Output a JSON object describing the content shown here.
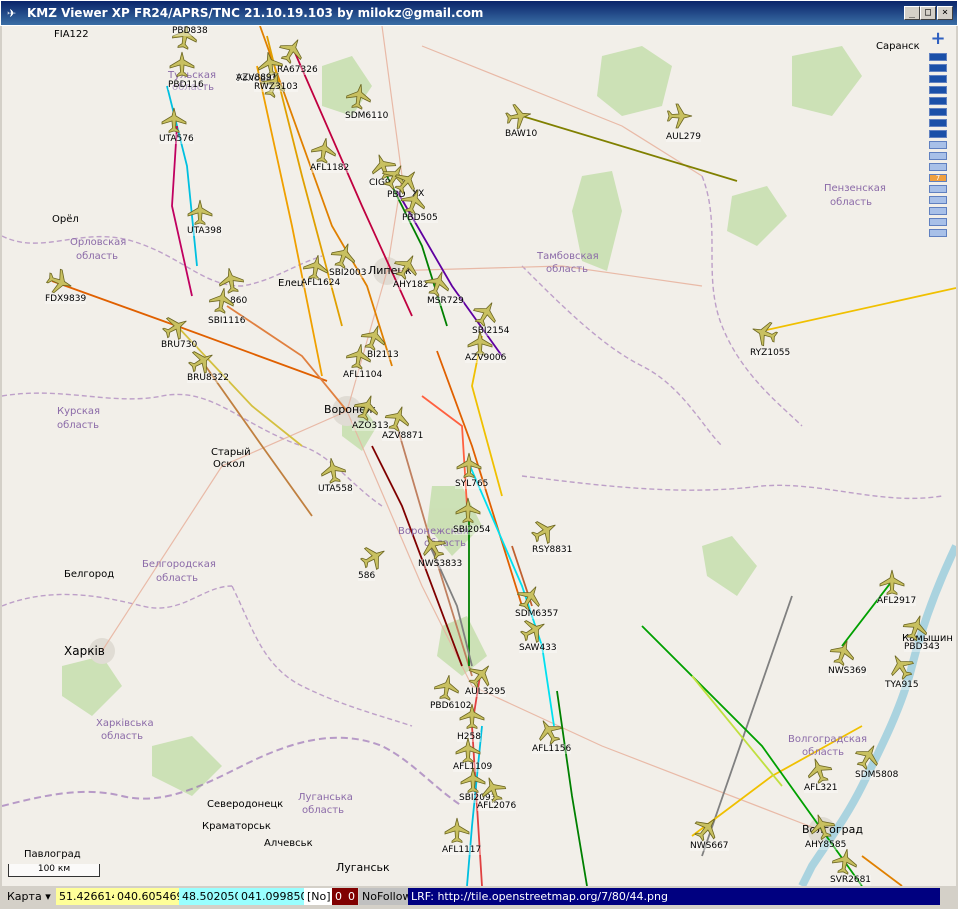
{
  "window": {
    "title": "KMZ Viewer XP FR24/APRS/TNC 21.10.19.103 by milokz@gmail.com",
    "minimize_glyph": "_",
    "maximize_glyph": "□",
    "close_glyph": "×"
  },
  "map": {
    "places": [
      {
        "name": "FIA122"
      },
      {
        "name": "Саранск"
      },
      {
        "name": "Пензенская"
      },
      {
        "name": "область"
      },
      {
        "name": "Орёл"
      },
      {
        "name": "Орловская"
      },
      {
        "name": "область"
      },
      {
        "name": "Тамбовская"
      },
      {
        "name": "область"
      },
      {
        "name": "Липецк"
      },
      {
        "name": "Елец"
      },
      {
        "name": "Курская"
      },
      {
        "name": "область"
      },
      {
        "name": "Старый"
      },
      {
        "name": "Оскол"
      },
      {
        "name": "Воронеж"
      },
      {
        "name": "Воронежская"
      },
      {
        "name": "область"
      },
      {
        "name": "Белгород"
      },
      {
        "name": "Белгородская"
      },
      {
        "name": "область"
      },
      {
        "name": "Харків"
      },
      {
        "name": "Харківська"
      },
      {
        "name": "область"
      },
      {
        "name": "Северодонецк"
      },
      {
        "name": "Луганська"
      },
      {
        "name": "область"
      },
      {
        "name": "Краматорськ"
      },
      {
        "name": "Алчевськ"
      },
      {
        "name": "Луганськ"
      },
      {
        "name": "Павлоград"
      },
      {
        "name": "Волгоградская"
      },
      {
        "name": "область"
      },
      {
        "name": "Волгоград"
      },
      {
        "name": "Камышин"
      },
      {
        "name": "Тульская"
      },
      {
        "name": "область"
      },
      {
        "name": "Узловая"
      }
    ],
    "scale_label": "100 км",
    "zoom_plus": "+",
    "zoom_level": "7",
    "flights": [
      {
        "callsign": "PBD838"
      },
      {
        "callsign": "RA67326"
      },
      {
        "callsign": "AZV8891"
      },
      {
        "callsign": "RWZ3103"
      },
      {
        "callsign": "PBD116"
      },
      {
        "callsign": "SDM6110"
      },
      {
        "callsign": "BAW10"
      },
      {
        "callsign": "AUL279"
      },
      {
        "callsign": "UTA576"
      },
      {
        "callsign": "AFL1182"
      },
      {
        "callsign": "CIG9"
      },
      {
        "callsign": "PBD"
      },
      {
        "callsign": "XX"
      },
      {
        "callsign": "PBD505"
      },
      {
        "callsign": "UTA398"
      },
      {
        "callsign": "SBI2003"
      },
      {
        "callsign": "AFL1624"
      },
      {
        "callsign": "AHY182"
      },
      {
        "callsign": "MSR729"
      },
      {
        "callsign": "FDX9839"
      },
      {
        "callsign": "860"
      },
      {
        "callsign": "SBI1116"
      },
      {
        "callsign": "SBI2154"
      },
      {
        "callsign": "AZV9006"
      },
      {
        "callsign": "RYZ1055"
      },
      {
        "callsign": "BRU730"
      },
      {
        "callsign": "BI2113"
      },
      {
        "callsign": "BRU8322"
      },
      {
        "callsign": "AFL1104"
      },
      {
        "callsign": "AZO313"
      },
      {
        "callsign": "AZV8871"
      },
      {
        "callsign": "SYL765"
      },
      {
        "callsign": "UTA558"
      },
      {
        "callsign": "SBI2054"
      },
      {
        "callsign": "RSY8831"
      },
      {
        "callsign": "NWS3833"
      },
      {
        "callsign": "586"
      },
      {
        "callsign": "AFL2917"
      },
      {
        "callsign": "SDM6357"
      },
      {
        "callsign": "SAW433"
      },
      {
        "callsign": "PBD343"
      },
      {
        "callsign": "NWS369"
      },
      {
        "callsign": "TYA915"
      },
      {
        "callsign": "AUL3295"
      },
      {
        "callsign": "PBD6102"
      },
      {
        "callsign": "H258"
      },
      {
        "callsign": "AFL1156"
      },
      {
        "callsign": "AFL1109"
      },
      {
        "callsign": "SDM5808"
      },
      {
        "callsign": "AFL321"
      },
      {
        "callsign": "SBI2093"
      },
      {
        "callsign": "AFL2076"
      },
      {
        "callsign": "NWS667"
      },
      {
        "callsign": "AHY8585"
      },
      {
        "callsign": "AFL1117"
      },
      {
        "callsign": "SVR2681"
      }
    ]
  },
  "status": {
    "mode_label": "Карта",
    "coord1_lat": "51.426614",
    "coord1_lon": "040.605469",
    "coord2_lat": "48.502050",
    "coord2_lon": "041.099850",
    "no_flag": "[No]",
    "counter_a": "0",
    "counter_b": "0",
    "follow": "NoFollow",
    "tile_url": "LRF: http://tile.openstreetmap.org/7/80/44.png"
  },
  "colors": {
    "titlebar": "#0a246a",
    "map_bg": "#f2efe9",
    "forest": "#c8dfb0",
    "aircraft": "#c8c060",
    "lat_bg": "#ffff99",
    "lon2_bg": "#99ffff",
    "counter_bg": "#800000",
    "url_bg": "#000080"
  }
}
